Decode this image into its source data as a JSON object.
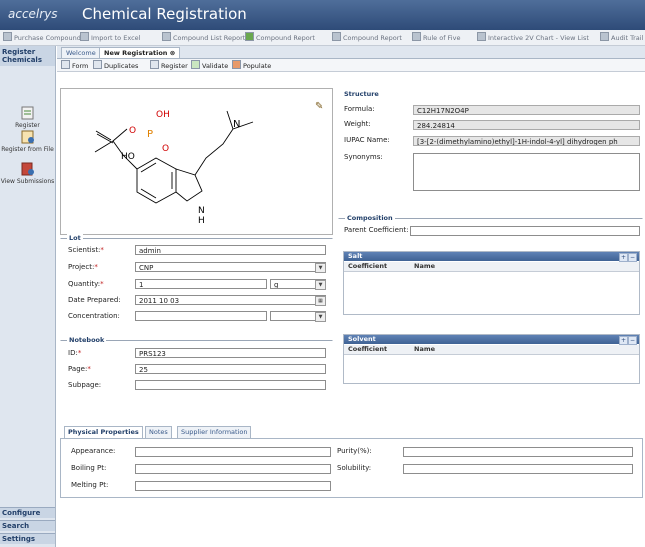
{
  "app": {
    "logo": "accelrys",
    "title": "Chemical Registration"
  },
  "toolbar": {
    "items": [
      {
        "label": "Purchase Compounds",
        "icon": "cart-icon"
      },
      {
        "label": "Import to Excel",
        "icon": "import-icon"
      },
      {
        "label": "Compound List Report",
        "icon": "report-icon"
      },
      {
        "label": "Compound Report",
        "icon": "compound-report-icon"
      },
      {
        "label": "Compound Report",
        "icon": "report-icon"
      },
      {
        "label": "Rule of Five",
        "icon": "rule-icon"
      },
      {
        "label": "Interactive 2V Chart - View List",
        "icon": "chart-icon"
      },
      {
        "label": "Audit Trail",
        "icon": "audit-icon"
      }
    ]
  },
  "sidebar": {
    "header": "Register Chemicals",
    "items": [
      {
        "label": "Register",
        "icon": "register-icon"
      },
      {
        "label": "Register from File",
        "icon": "register-file-icon"
      },
      {
        "label": "View Submissions",
        "icon": "view-submissions-icon"
      }
    ],
    "bottom": [
      "Configure",
      "Search",
      "Settings"
    ]
  },
  "tabs": [
    {
      "label": "Welcome"
    },
    {
      "label": "New Registration"
    }
  ],
  "subtoolbar": [
    {
      "label": "Form",
      "icon": "form-icon"
    },
    {
      "label": "Duplicates",
      "icon": "duplicates-icon"
    },
    {
      "label": "Register",
      "icon": "register-icon"
    },
    {
      "label": "Validate",
      "icon": "validate-icon"
    },
    {
      "label": "Populate",
      "icon": "populate-icon"
    }
  ],
  "structure_labels": {
    "oh": "OH",
    "o1": "O",
    "p": "P",
    "o2": "O",
    "ho": "HO",
    "n": "N",
    "nh_n": "N",
    "nh_h": "H"
  },
  "structure": {
    "legend": "Structure",
    "formula_label": "Formula:",
    "formula_value": "C12H17N2O4P",
    "weight_label": "Weight:",
    "weight_value": "284.24814",
    "iupac_label": "IUPAC Name:",
    "iupac_value": "[3-[2-(dimethylamino)ethyl]-1H-indol-4-yl] dihydrogen ph",
    "synonyms_label": "Synonyms:"
  },
  "lot": {
    "legend": "Lot",
    "scientist_label": "Scientist:",
    "scientist_value": "admin",
    "project_label": "Project:",
    "project_value": "CNP",
    "quantity_label": "Quantity:",
    "quantity_value": "1",
    "quantity_unit": "g",
    "date_label": "Date Prepared:",
    "date_value": "2011 10 03",
    "concentration_label": "Concentration:"
  },
  "notebook": {
    "legend": "Notebook",
    "id_label": "ID:",
    "id_value": "PRS123",
    "page_label": "Page:",
    "page_value": "25",
    "subpage_label": "Subpage:"
  },
  "composition": {
    "legend": "Composition",
    "parent_label": "Parent Coefficient:",
    "salt": {
      "title": "Salt",
      "col1": "Coefficient",
      "col2": "Name"
    },
    "solvent": {
      "title": "Solvent",
      "col1": "Coefficient",
      "col2": "Name"
    }
  },
  "bottom_tabs": [
    {
      "label": "Physical Properties"
    },
    {
      "label": "Notes"
    },
    {
      "label": "Supplier Information"
    }
  ],
  "physical": {
    "appearance_label": "Appearance:",
    "boiling_label": "Boiling Pt:",
    "melting_label": "Melting Pt:",
    "purity_label": "Purity(%):",
    "solubility_label": "Solubility:"
  },
  "colors": {
    "titlebar": "#2e4b78",
    "panel_header": "#3f6294",
    "required": "#c02020",
    "p_atom": "#e08000",
    "o_atom": "#d00000",
    "n_atom": "#1030c0"
  }
}
